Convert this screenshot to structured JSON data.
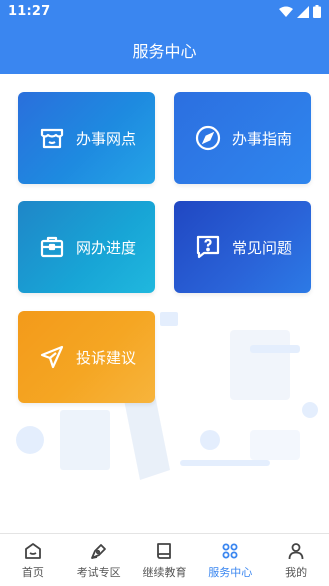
{
  "status_bar": {
    "time": "11:27"
  },
  "header": {
    "title": "服务中心"
  },
  "cards": [
    {
      "label": "办事网点",
      "icon": "shop-icon"
    },
    {
      "label": "办事指南",
      "icon": "compass-icon"
    },
    {
      "label": "网办进度",
      "icon": "briefcase-icon"
    },
    {
      "label": "常见问题",
      "icon": "question-icon"
    },
    {
      "label": "投诉建议",
      "icon": "send-icon"
    }
  ],
  "tabbar": {
    "active": "服务中心",
    "items": [
      {
        "label": "首页",
        "icon": "home-icon"
      },
      {
        "label": "考试专区",
        "icon": "pen-icon"
      },
      {
        "label": "继续教育",
        "icon": "book-icon"
      },
      {
        "label": "服务中心",
        "icon": "grid-icon"
      },
      {
        "label": "我的",
        "icon": "user-icon"
      }
    ]
  },
  "colors": {
    "primary": "#3a86f0",
    "orange": "#f5a623"
  }
}
